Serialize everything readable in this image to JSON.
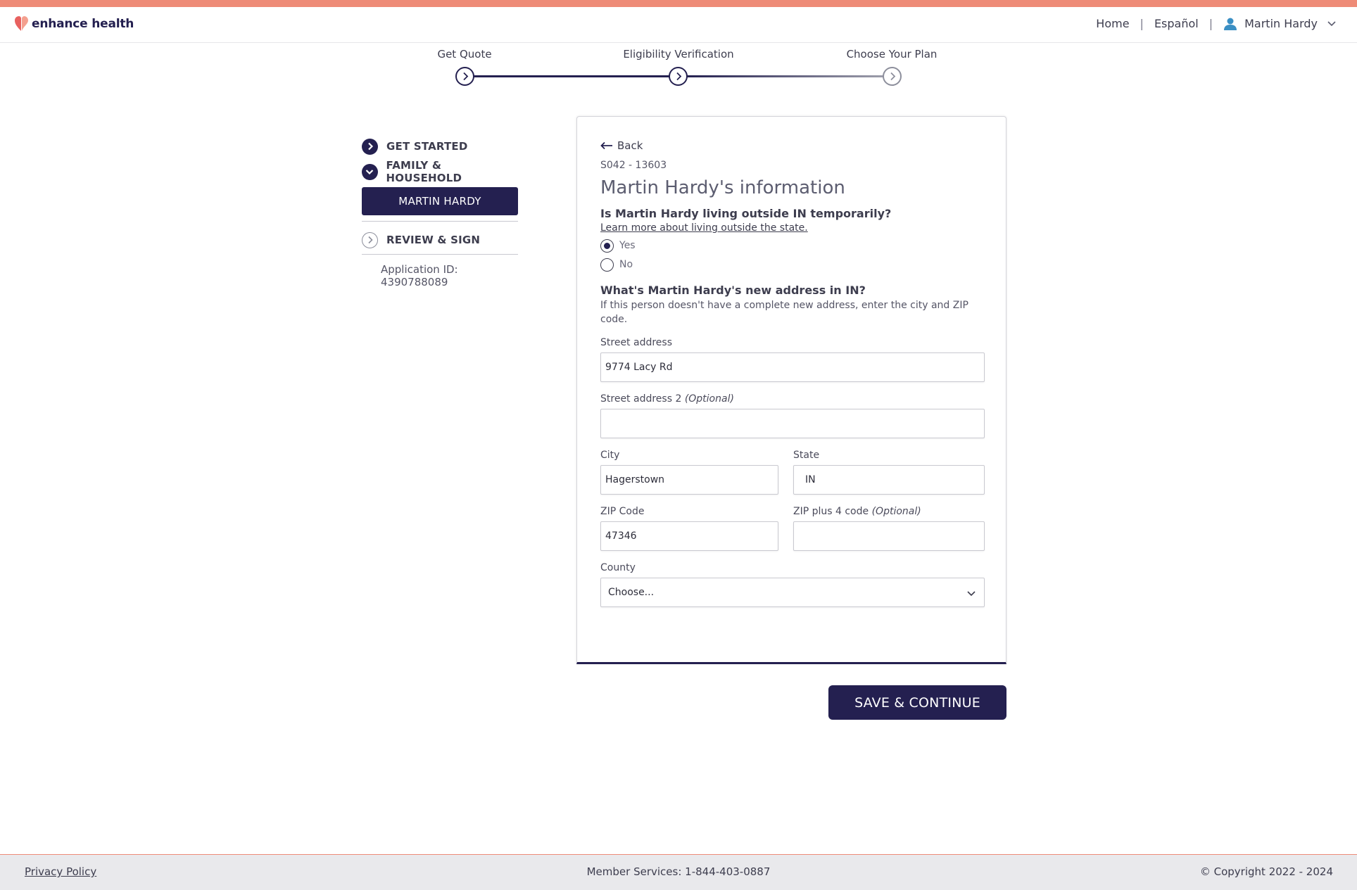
{
  "app": {
    "brand": "enhance health"
  },
  "header": {
    "nav": {
      "home": "Home",
      "language": "Español",
      "user_name": "Martin Hardy"
    }
  },
  "stepper": {
    "steps": [
      {
        "label": "Get Quote",
        "state": "complete"
      },
      {
        "label": "Eligibility Verification",
        "state": "current"
      },
      {
        "label": "Choose Your Plan",
        "state": "upcoming"
      }
    ]
  },
  "sidenav": {
    "items": [
      {
        "label": "GET STARTED",
        "icon": "chevron-right-filled-icon"
      },
      {
        "label": "FAMILY & HOUSEHOLD",
        "icon": "chevron-down-filled-icon"
      },
      {
        "label": "REVIEW & SIGN",
        "icon": "chevron-right-outline-icon"
      }
    ],
    "sub_item": "MARTIN HARDY",
    "application_id": "Application ID: 4390788089"
  },
  "form": {
    "back_label": "Back",
    "case_id": "S042 - 13603",
    "title": "Martin Hardy's information",
    "question_outside": "Is Martin Hardy living outside IN temporarily?",
    "learn_more_link": "Learn more about living outside the state.",
    "radio_yes": "Yes",
    "radio_no": "No",
    "selected_option": "Yes",
    "question_address": "What's Martin Hardy's new address in IN?",
    "address_help": "If this person doesn't have a complete new address, enter the city and ZIP code.",
    "street_label": "Street address",
    "street_value": "9774 Lacy Rd",
    "street2_label": "Street address 2",
    "optional_tag": "(Optional)",
    "street2_value": "",
    "city_label": "City",
    "city_value": "Hagerstown",
    "state_label": "State",
    "state_value": "IN",
    "zip_label": "ZIP Code",
    "zip_value": "47346",
    "zip4_label": "ZIP plus 4 code",
    "zip4_value": "",
    "county_label": "County",
    "county_value": "Choose..."
  },
  "actions": {
    "save_label": "SAVE & CONTINUE"
  },
  "footer": {
    "privacy": "Privacy Policy",
    "member_services": "Member Services: 1-844-403-0887",
    "copyright": "© Copyright 2022 - 2024"
  },
  "colors": {
    "brand_navy": "#242050",
    "accent_coral": "#ee8b77",
    "heart_red": "#e8615f",
    "heart_pink": "#f4a08f",
    "user_icon_blue": "#3a8fc4"
  }
}
